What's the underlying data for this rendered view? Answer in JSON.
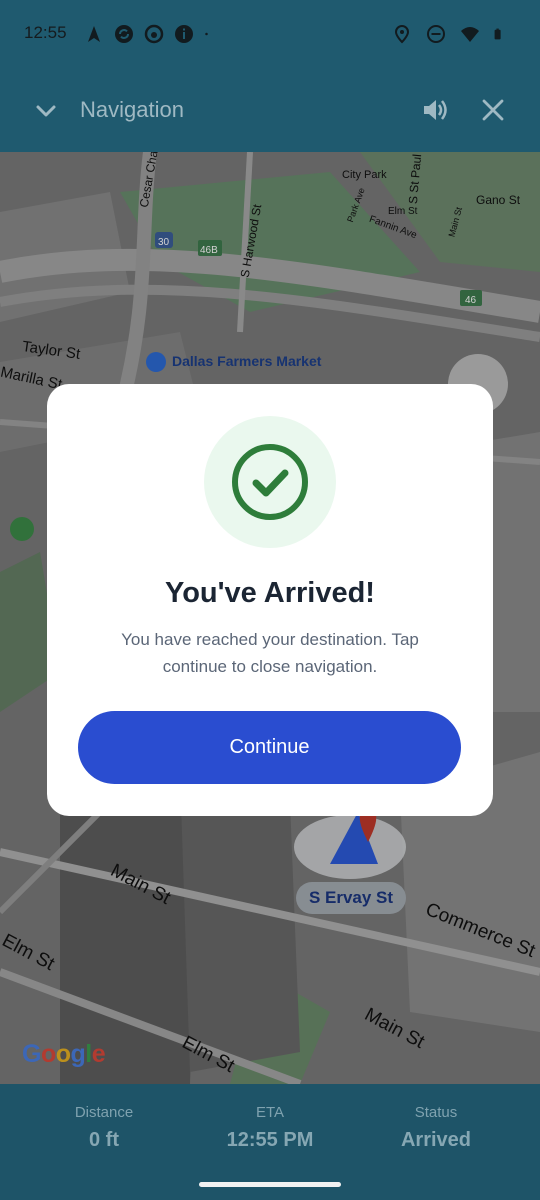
{
  "status_bar": {
    "time": "12:55",
    "left_icons": [
      "navigation-arrow-icon",
      "sync-icon",
      "camera-icon",
      "info-icon",
      "dot-icon"
    ],
    "right_icons": [
      "location-icon",
      "do-not-disturb-icon",
      "wifi-icon",
      "battery-icon"
    ]
  },
  "app_bar": {
    "title": "Navigation",
    "icons": [
      "chevron-down-icon",
      "volume-icon",
      "close-icon"
    ]
  },
  "map": {
    "labels": {
      "city_park": "City Park",
      "elm_st_top": "Elm St",
      "gano_st": "Gano St",
      "fannin_ave": "Fannin Ave",
      "park_ave": "Park Ave",
      "main_st_top": "Main St",
      "cesar_chavez": "Cesar Cha",
      "s_harwood_st": "S Harwood St",
      "s_st_paul": "S St Paul",
      "taylor_st": "Taylor St",
      "marilla_st": "Marilla St",
      "dallas_farmers_market": "Dallas Farmers Market",
      "main_st_1": "Main St",
      "main_st_2": "Main St",
      "elm_st_1": "Elm St",
      "elm_st_2": "Elm St",
      "commerce_st": "Commerce St",
      "highway_30": "30",
      "highway_46b": "46B",
      "highway_46": "46"
    },
    "street_pill": "S Ervay St",
    "attribution": "Google"
  },
  "dialog": {
    "heading": "You've Arrived!",
    "message": "You have reached your destination. Tap continue to close navigation.",
    "continue_label": "Continue",
    "accent_color": "#2a4dd0",
    "success_color": "#2e7d3a"
  },
  "bottom_panel": {
    "distance": {
      "label": "Distance",
      "value": "0 ft"
    },
    "eta": {
      "label": "ETA",
      "value": "12:55 PM"
    },
    "status": {
      "label": "Status",
      "value": "Arrived"
    }
  }
}
